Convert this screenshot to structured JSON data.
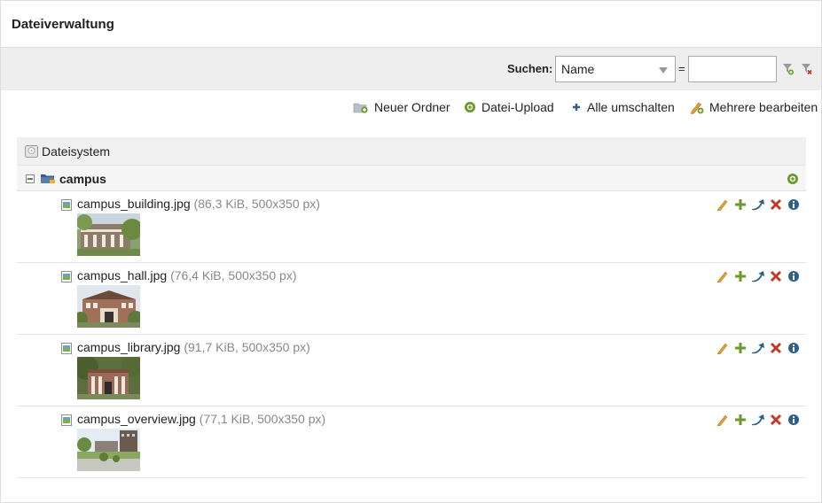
{
  "page": {
    "title": "Dateiverwaltung"
  },
  "search": {
    "label": "Suchen:",
    "field_selected": "Name",
    "operator": "=",
    "value": ""
  },
  "toolbar": {
    "new_folder": "Neuer Ordner",
    "upload": "Datei-Upload",
    "toggle_all": "Alle umschalten",
    "edit_multiple": "Mehrere bearbeiten"
  },
  "tree": {
    "root_label": "Dateisystem",
    "folder_label": "campus",
    "files": [
      {
        "name": "campus_building.jpg",
        "meta": "(86,3 KiB, 500x350 px)"
      },
      {
        "name": "campus_hall.jpg",
        "meta": "(76,4 KiB, 500x350 px)"
      },
      {
        "name": "campus_library.jpg",
        "meta": "(91,7 KiB, 500x350 px)"
      },
      {
        "name": "campus_overview.jpg",
        "meta": "(77,1 KiB, 500x350 px)"
      }
    ]
  },
  "colors": {
    "accent_green": "#6a9a2a",
    "edit_orange": "#e0a030",
    "delete_red": "#c0392b",
    "info_blue": "#2d5f8a"
  }
}
